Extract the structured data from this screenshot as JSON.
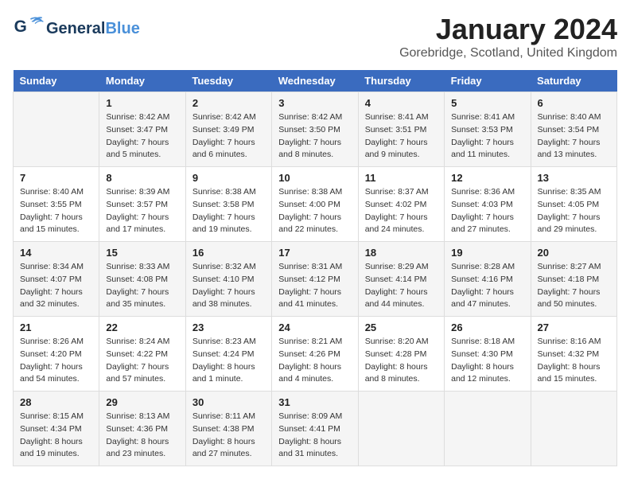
{
  "header": {
    "logo_general": "General",
    "logo_blue": "Blue",
    "month_year": "January 2024",
    "location": "Gorebridge, Scotland, United Kingdom"
  },
  "weekdays": [
    "Sunday",
    "Monday",
    "Tuesday",
    "Wednesday",
    "Thursday",
    "Friday",
    "Saturday"
  ],
  "weeks": [
    [
      {
        "day": "",
        "sunrise": "",
        "sunset": "",
        "daylight": ""
      },
      {
        "day": "1",
        "sunrise": "Sunrise: 8:42 AM",
        "sunset": "Sunset: 3:47 PM",
        "daylight": "Daylight: 7 hours and 5 minutes."
      },
      {
        "day": "2",
        "sunrise": "Sunrise: 8:42 AM",
        "sunset": "Sunset: 3:49 PM",
        "daylight": "Daylight: 7 hours and 6 minutes."
      },
      {
        "day": "3",
        "sunrise": "Sunrise: 8:42 AM",
        "sunset": "Sunset: 3:50 PM",
        "daylight": "Daylight: 7 hours and 8 minutes."
      },
      {
        "day": "4",
        "sunrise": "Sunrise: 8:41 AM",
        "sunset": "Sunset: 3:51 PM",
        "daylight": "Daylight: 7 hours and 9 minutes."
      },
      {
        "day": "5",
        "sunrise": "Sunrise: 8:41 AM",
        "sunset": "Sunset: 3:53 PM",
        "daylight": "Daylight: 7 hours and 11 minutes."
      },
      {
        "day": "6",
        "sunrise": "Sunrise: 8:40 AM",
        "sunset": "Sunset: 3:54 PM",
        "daylight": "Daylight: 7 hours and 13 minutes."
      }
    ],
    [
      {
        "day": "7",
        "sunrise": "Sunrise: 8:40 AM",
        "sunset": "Sunset: 3:55 PM",
        "daylight": "Daylight: 7 hours and 15 minutes."
      },
      {
        "day": "8",
        "sunrise": "Sunrise: 8:39 AM",
        "sunset": "Sunset: 3:57 PM",
        "daylight": "Daylight: 7 hours and 17 minutes."
      },
      {
        "day": "9",
        "sunrise": "Sunrise: 8:38 AM",
        "sunset": "Sunset: 3:58 PM",
        "daylight": "Daylight: 7 hours and 19 minutes."
      },
      {
        "day": "10",
        "sunrise": "Sunrise: 8:38 AM",
        "sunset": "Sunset: 4:00 PM",
        "daylight": "Daylight: 7 hours and 22 minutes."
      },
      {
        "day": "11",
        "sunrise": "Sunrise: 8:37 AM",
        "sunset": "Sunset: 4:02 PM",
        "daylight": "Daylight: 7 hours and 24 minutes."
      },
      {
        "day": "12",
        "sunrise": "Sunrise: 8:36 AM",
        "sunset": "Sunset: 4:03 PM",
        "daylight": "Daylight: 7 hours and 27 minutes."
      },
      {
        "day": "13",
        "sunrise": "Sunrise: 8:35 AM",
        "sunset": "Sunset: 4:05 PM",
        "daylight": "Daylight: 7 hours and 29 minutes."
      }
    ],
    [
      {
        "day": "14",
        "sunrise": "Sunrise: 8:34 AM",
        "sunset": "Sunset: 4:07 PM",
        "daylight": "Daylight: 7 hours and 32 minutes."
      },
      {
        "day": "15",
        "sunrise": "Sunrise: 8:33 AM",
        "sunset": "Sunset: 4:08 PM",
        "daylight": "Daylight: 7 hours and 35 minutes."
      },
      {
        "day": "16",
        "sunrise": "Sunrise: 8:32 AM",
        "sunset": "Sunset: 4:10 PM",
        "daylight": "Daylight: 7 hours and 38 minutes."
      },
      {
        "day": "17",
        "sunrise": "Sunrise: 8:31 AM",
        "sunset": "Sunset: 4:12 PM",
        "daylight": "Daylight: 7 hours and 41 minutes."
      },
      {
        "day": "18",
        "sunrise": "Sunrise: 8:29 AM",
        "sunset": "Sunset: 4:14 PM",
        "daylight": "Daylight: 7 hours and 44 minutes."
      },
      {
        "day": "19",
        "sunrise": "Sunrise: 8:28 AM",
        "sunset": "Sunset: 4:16 PM",
        "daylight": "Daylight: 7 hours and 47 minutes."
      },
      {
        "day": "20",
        "sunrise": "Sunrise: 8:27 AM",
        "sunset": "Sunset: 4:18 PM",
        "daylight": "Daylight: 7 hours and 50 minutes."
      }
    ],
    [
      {
        "day": "21",
        "sunrise": "Sunrise: 8:26 AM",
        "sunset": "Sunset: 4:20 PM",
        "daylight": "Daylight: 7 hours and 54 minutes."
      },
      {
        "day": "22",
        "sunrise": "Sunrise: 8:24 AM",
        "sunset": "Sunset: 4:22 PM",
        "daylight": "Daylight: 7 hours and 57 minutes."
      },
      {
        "day": "23",
        "sunrise": "Sunrise: 8:23 AM",
        "sunset": "Sunset: 4:24 PM",
        "daylight": "Daylight: 8 hours and 1 minute."
      },
      {
        "day": "24",
        "sunrise": "Sunrise: 8:21 AM",
        "sunset": "Sunset: 4:26 PM",
        "daylight": "Daylight: 8 hours and 4 minutes."
      },
      {
        "day": "25",
        "sunrise": "Sunrise: 8:20 AM",
        "sunset": "Sunset: 4:28 PM",
        "daylight": "Daylight: 8 hours and 8 minutes."
      },
      {
        "day": "26",
        "sunrise": "Sunrise: 8:18 AM",
        "sunset": "Sunset: 4:30 PM",
        "daylight": "Daylight: 8 hours and 12 minutes."
      },
      {
        "day": "27",
        "sunrise": "Sunrise: 8:16 AM",
        "sunset": "Sunset: 4:32 PM",
        "daylight": "Daylight: 8 hours and 15 minutes."
      }
    ],
    [
      {
        "day": "28",
        "sunrise": "Sunrise: 8:15 AM",
        "sunset": "Sunset: 4:34 PM",
        "daylight": "Daylight: 8 hours and 19 minutes."
      },
      {
        "day": "29",
        "sunrise": "Sunrise: 8:13 AM",
        "sunset": "Sunset: 4:36 PM",
        "daylight": "Daylight: 8 hours and 23 minutes."
      },
      {
        "day": "30",
        "sunrise": "Sunrise: 8:11 AM",
        "sunset": "Sunset: 4:38 PM",
        "daylight": "Daylight: 8 hours and 27 minutes."
      },
      {
        "day": "31",
        "sunrise": "Sunrise: 8:09 AM",
        "sunset": "Sunset: 4:41 PM",
        "daylight": "Daylight: 8 hours and 31 minutes."
      },
      {
        "day": "",
        "sunrise": "",
        "sunset": "",
        "daylight": ""
      },
      {
        "day": "",
        "sunrise": "",
        "sunset": "",
        "daylight": ""
      },
      {
        "day": "",
        "sunrise": "",
        "sunset": "",
        "daylight": ""
      }
    ]
  ]
}
